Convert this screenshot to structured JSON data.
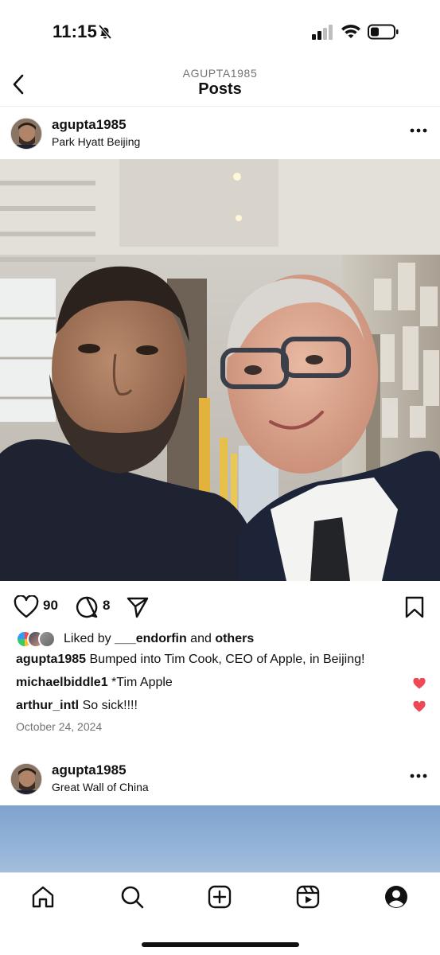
{
  "status_bar": {
    "time": "11:15"
  },
  "header": {
    "account": "AGUPTA1985",
    "title": "Posts"
  },
  "posts": [
    {
      "username": "agupta1985",
      "location": "Park Hyatt Beijing",
      "likes_count": "90",
      "comments_count": "8",
      "liked_by_prefix": "Liked by ",
      "liked_by_user": "___endorfin",
      "liked_by_and": " and ",
      "liked_by_others": "others",
      "caption_user": "agupta1985",
      "caption_text": " Bumped into Tim Cook, CEO of Apple, in Beijing!",
      "comments": [
        {
          "user": "michaelbiddle1",
          "text": " *Tim Apple"
        },
        {
          "user": "arthur_intl",
          "text": " So sick!!!!"
        }
      ],
      "date": "October 24, 2024"
    },
    {
      "username": "agupta1985",
      "location": "Great Wall of China"
    }
  ],
  "tab_bar": {
    "items": [
      "home-icon",
      "search-icon",
      "create-icon",
      "reels-icon",
      "profile-icon"
    ]
  },
  "colors": {
    "accent_heart": "#ed4956",
    "secondary_text": "#737373"
  }
}
